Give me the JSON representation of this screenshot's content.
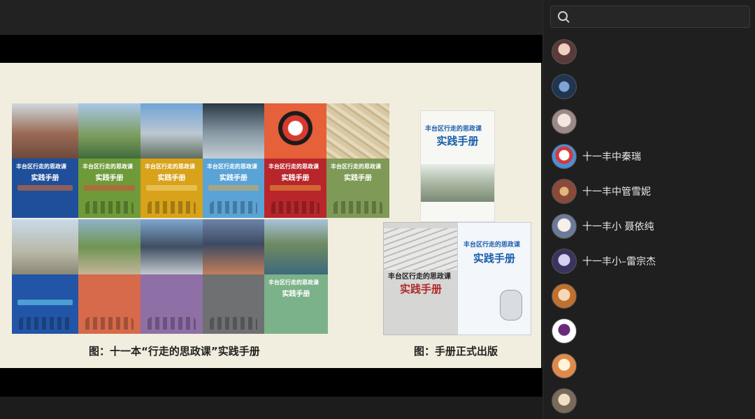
{
  "slide": {
    "covers_set1": [
      {
        "t1": "丰台区行走的思政课",
        "t2": "实践手册"
      },
      {
        "t1": "丰台区行走的思政课",
        "t2": "实践手册"
      },
      {
        "t1": "丰台区行走的思政课",
        "t2": "实践手册"
      },
      {
        "t1": "丰台区行走的思政课",
        "t2": "实践手册"
      },
      {
        "t1": "丰台区行走的思政课",
        "t2": "实践手册"
      },
      {
        "t1": "丰台区行走的思政课",
        "t2": "实践手册"
      }
    ],
    "covers_set2": [
      {
        "t1": "",
        "t2": ""
      },
      {
        "t1": "",
        "t2": ""
      },
      {
        "t1": "",
        "t2": ""
      },
      {
        "t1": "",
        "t2": ""
      },
      {
        "t1": "丰台区行走的思政课",
        "t2": "实践手册"
      }
    ],
    "caption_left": "图：十一本“行走的思政课”实践手册",
    "caption_right": "图：手册正式出版",
    "book_right_top": {
      "t1": "丰台区行走的思政课",
      "t2": "实践手册"
    },
    "book_right_left": {
      "t1": "丰台区行走的思政课",
      "t2": "实践手册"
    },
    "book_right_right": {
      "t1": "丰台区行走的思政课",
      "t2": "实践手册"
    }
  },
  "sidebar": {
    "members": [
      {
        "name": ""
      },
      {
        "name": ""
      },
      {
        "name": ""
      },
      {
        "name": "十一丰中秦瑞"
      },
      {
        "name": "十一丰中管雪妮"
      },
      {
        "name": "十一丰小 聂依纯"
      },
      {
        "name": "十一丰小–雷宗杰"
      },
      {
        "name": ""
      },
      {
        "name": ""
      },
      {
        "name": ""
      },
      {
        "name": ""
      }
    ]
  },
  "colors": {
    "cover_blue": "#1f4f9a",
    "cover_green": "#6f9a3a",
    "cover_yellow": "#d8a21b",
    "cover_sky": "#5aa3d6",
    "cover_red": "#b8262b",
    "cover_olive": "#7f9a56"
  }
}
